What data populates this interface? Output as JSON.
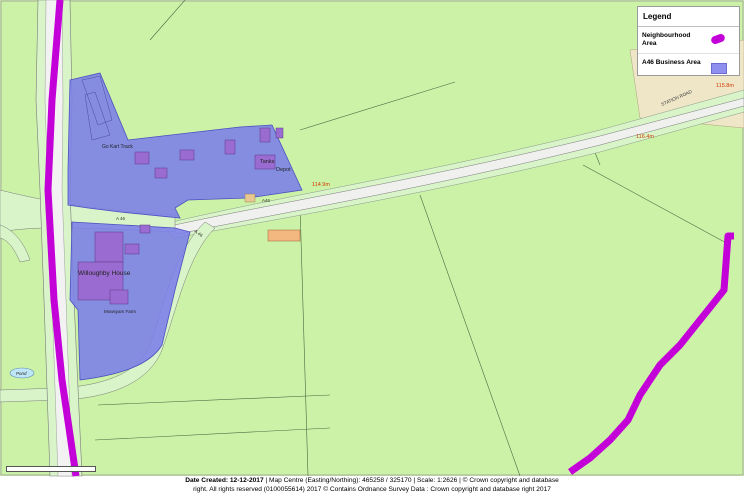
{
  "legend": {
    "title": "Legend",
    "items": [
      {
        "label": "Neighbourhood Area",
        "color": "#c400d8"
      },
      {
        "label": "A46 Business Area",
        "color": "#8f8ff0"
      }
    ]
  },
  "map_labels": {
    "go_kart": "Go Kart Track",
    "tanks": "Tanks",
    "depot": "Depot",
    "willoughby": "Willoughby House",
    "mowsyam": "Mowsyam Farm",
    "pond": "Pond",
    "a46_a": "A 46",
    "a46_b": "A 46",
    "a46_c": "A46",
    "station_road": "STATION ROAD",
    "h1": "114.9m",
    "h2": "116.4m",
    "h3": "115.8m"
  },
  "footer": {
    "date_label": "Date Created: 12-12-2017",
    "line1_rest": " | Map Centre (Easting/Northing): 465258 / 325170 | Scale: 1:2626 | © Crown copyright and database",
    "line2": "right. All rights reserved (0100055614) 2017 © Contains Ordnance Survey Data : Crown copyright and database right 2017"
  },
  "colors": {
    "grass": "#ccf2a8",
    "road_verge": "#d8f4c8",
    "road": "#f2f2f2",
    "neighbourhood": "#c400d8",
    "business_fill": "#7b7ee8",
    "business_stroke": "#4b4fc0",
    "field_line": "#2a4a2a"
  }
}
